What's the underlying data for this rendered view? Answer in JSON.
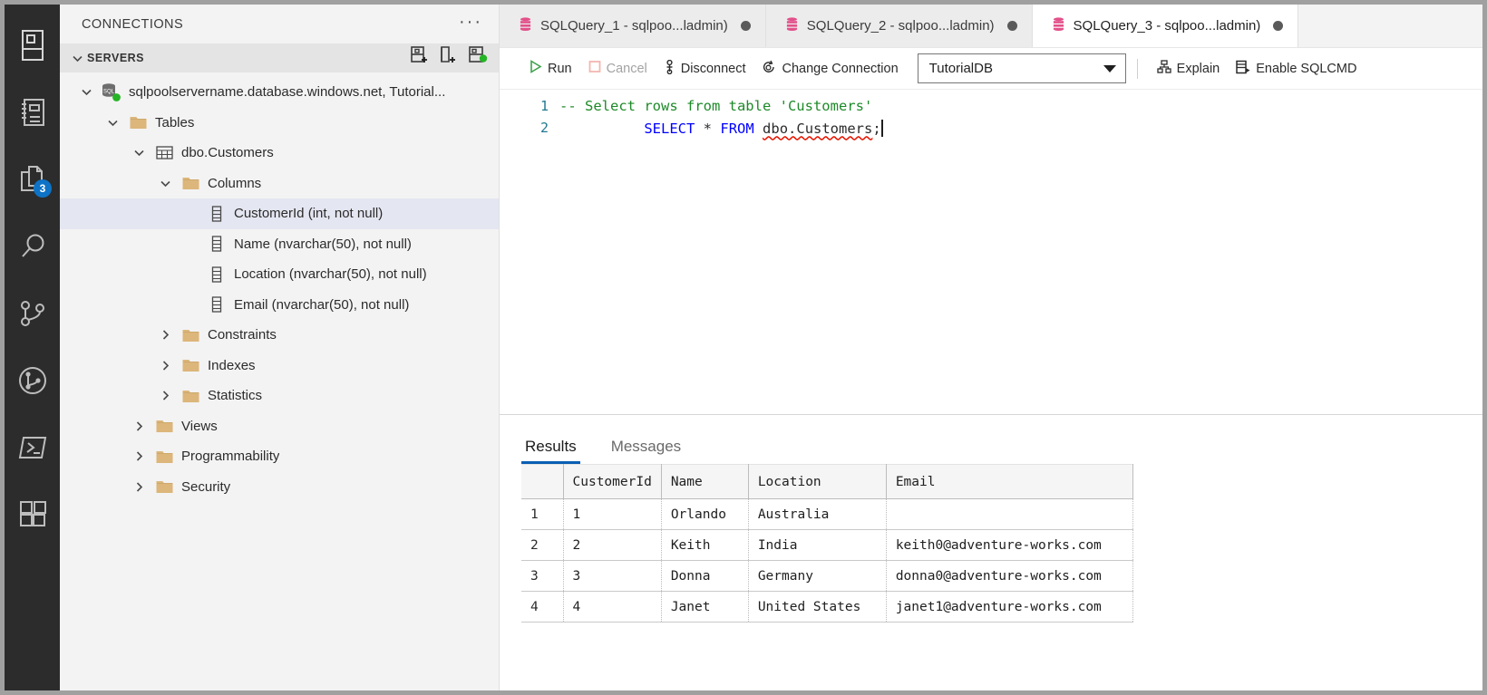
{
  "activity_bar": {
    "items": [
      {
        "name": "servers-icon",
        "label": "Servers",
        "badge": null
      },
      {
        "name": "notebook-icon",
        "label": "Notebooks",
        "badge": null
      },
      {
        "name": "source-files-icon",
        "label": "Explorer",
        "badge": "3"
      },
      {
        "name": "search-icon",
        "label": "Search",
        "badge": null
      },
      {
        "name": "source-control-icon",
        "label": "Source Control",
        "badge": null
      },
      {
        "name": "git-graph-icon",
        "label": "Git Graph",
        "badge": null
      },
      {
        "name": "terminal-icon",
        "label": "Terminal",
        "badge": null
      },
      {
        "name": "extensions-icon",
        "label": "Extensions",
        "badge": null
      }
    ]
  },
  "sidebar": {
    "title": "CONNECTIONS",
    "more_actions": "···",
    "section": {
      "label": "SERVERS",
      "actions": [
        {
          "name": "new-connection-icon",
          "label": "New Connection"
        },
        {
          "name": "new-server-group-icon",
          "label": "New Server Group"
        },
        {
          "name": "manage-connection-icon",
          "label": "Manage Connection"
        }
      ]
    },
    "tree": [
      {
        "label": "sqlpoolservername.database.windows.net, Tutorial...",
        "indent": 0,
        "twisty": "down",
        "icon": "sql-server-icon",
        "selected": false
      },
      {
        "label": "Tables",
        "indent": 1,
        "twisty": "down",
        "icon": "folder-icon",
        "selected": false
      },
      {
        "label": "dbo.Customers",
        "indent": 2,
        "twisty": "down",
        "icon": "table-icon",
        "selected": false
      },
      {
        "label": "Columns",
        "indent": 3,
        "twisty": "down",
        "icon": "folder-icon",
        "selected": false
      },
      {
        "label": "CustomerId (int, not null)",
        "indent": 4,
        "twisty": "none",
        "icon": "column-icon",
        "selected": true
      },
      {
        "label": "Name (nvarchar(50), not null)",
        "indent": 4,
        "twisty": "none",
        "icon": "column-icon",
        "selected": false
      },
      {
        "label": "Location (nvarchar(50), not null)",
        "indent": 4,
        "twisty": "none",
        "icon": "column-icon",
        "selected": false
      },
      {
        "label": "Email (nvarchar(50), not null)",
        "indent": 4,
        "twisty": "none",
        "icon": "column-icon",
        "selected": false
      },
      {
        "label": "Constraints",
        "indent": 3,
        "twisty": "right",
        "icon": "folder-icon",
        "selected": false
      },
      {
        "label": "Indexes",
        "indent": 3,
        "twisty": "right",
        "icon": "folder-icon",
        "selected": false
      },
      {
        "label": "Statistics",
        "indent": 3,
        "twisty": "right",
        "icon": "folder-icon",
        "selected": false
      },
      {
        "label": "Views",
        "indent": 2,
        "twisty": "right",
        "icon": "folder-icon",
        "selected": false
      },
      {
        "label": "Programmability",
        "indent": 2,
        "twisty": "right",
        "icon": "folder-icon",
        "selected": false
      },
      {
        "label": "Security",
        "indent": 2,
        "twisty": "right",
        "icon": "folder-icon",
        "selected": false
      }
    ]
  },
  "tabs": [
    {
      "label": "SQLQuery_1 - sqlpoo...ladmin)",
      "active": false,
      "dirty": true
    },
    {
      "label": "SQLQuery_2 - sqlpoo...ladmin)",
      "active": false,
      "dirty": true
    },
    {
      "label": "SQLQuery_3 - sqlpoo...ladmin)",
      "active": true,
      "dirty": true
    }
  ],
  "toolbar": {
    "run_label": "Run",
    "cancel_label": "Cancel",
    "disconnect_label": "Disconnect",
    "change_connection_label": "Change Connection",
    "database_value": "TutorialDB",
    "explain_label": "Explain",
    "enable_sqlcmd_label": "Enable SQLCMD"
  },
  "editor": {
    "lines": [
      {
        "no": "1",
        "comment": "-- Select rows from table 'Customers'"
      },
      {
        "no": "2",
        "kw1": "SELECT",
        "star": "*",
        "kw2": "FROM",
        "obj": "dbo.Customers",
        "semi": ";"
      }
    ]
  },
  "results": {
    "tabs": [
      {
        "label": "Results",
        "active": true
      },
      {
        "label": "Messages",
        "active": false
      }
    ],
    "columns": [
      "CustomerId",
      "Name",
      "Location",
      "Email"
    ],
    "rows": [
      {
        "n": "1",
        "CustomerId": "1",
        "Name": "Orlando",
        "Location": "Australia",
        "Email": ""
      },
      {
        "n": "2",
        "CustomerId": "2",
        "Name": "Keith",
        "Location": "India",
        "Email": "keith0@adventure-works.com"
      },
      {
        "n": "3",
        "CustomerId": "3",
        "Name": "Donna",
        "Location": "Germany",
        "Email": "donna0@adventure-works.com"
      },
      {
        "n": "4",
        "CustomerId": "4",
        "Name": "Janet",
        "Location": "United States",
        "Email": "janet1@adventure-works.com"
      }
    ]
  },
  "colors": {
    "accent": "#0a5eb3",
    "badge": "#0e73c6",
    "db_icon": "#e3508a",
    "run_green": "#3fa34d",
    "cancel_pink": "#f3b6ae",
    "status_green": "#25b425",
    "comment_green": "#1d8a28",
    "keyword_blue": "#0000ff",
    "error_red": "#e51400",
    "folder_tan": "#dcb67a"
  }
}
